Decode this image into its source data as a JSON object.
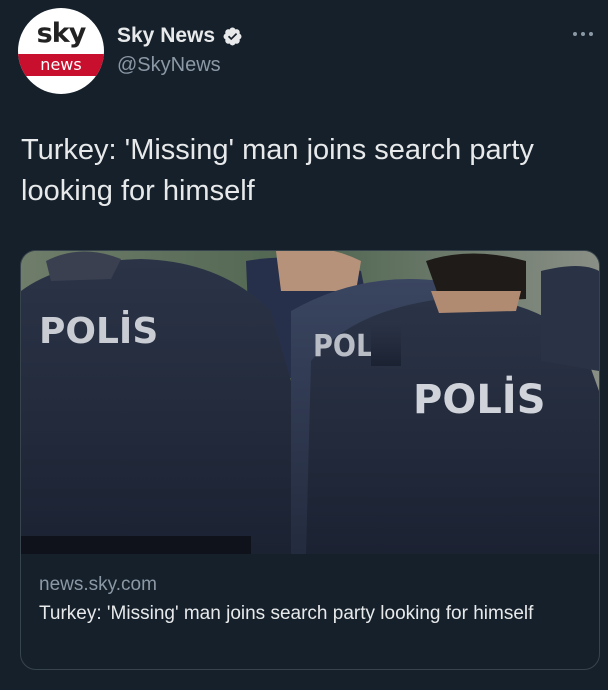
{
  "account": {
    "logo_top": "sky",
    "logo_bottom": "news",
    "display_name": "Sky News",
    "handle": "@SkyNews",
    "verified": true
  },
  "tweet": {
    "text": "Turkey: 'Missing' man joins search party looking for himself"
  },
  "card": {
    "image_text": "POLİS",
    "image_text_partial": "POLİS",
    "domain": "news.sky.com",
    "title": "Turkey: 'Missing' man joins search party looking for himself"
  },
  "icons": {
    "verified": "verified-badge-icon",
    "more": "more-horizontal-icon"
  },
  "colors": {
    "background": "#15202b",
    "text": "#e7e9ea",
    "secondary_text": "#8b98a5",
    "brand_red": "#c8102e",
    "border": "#38444d"
  }
}
